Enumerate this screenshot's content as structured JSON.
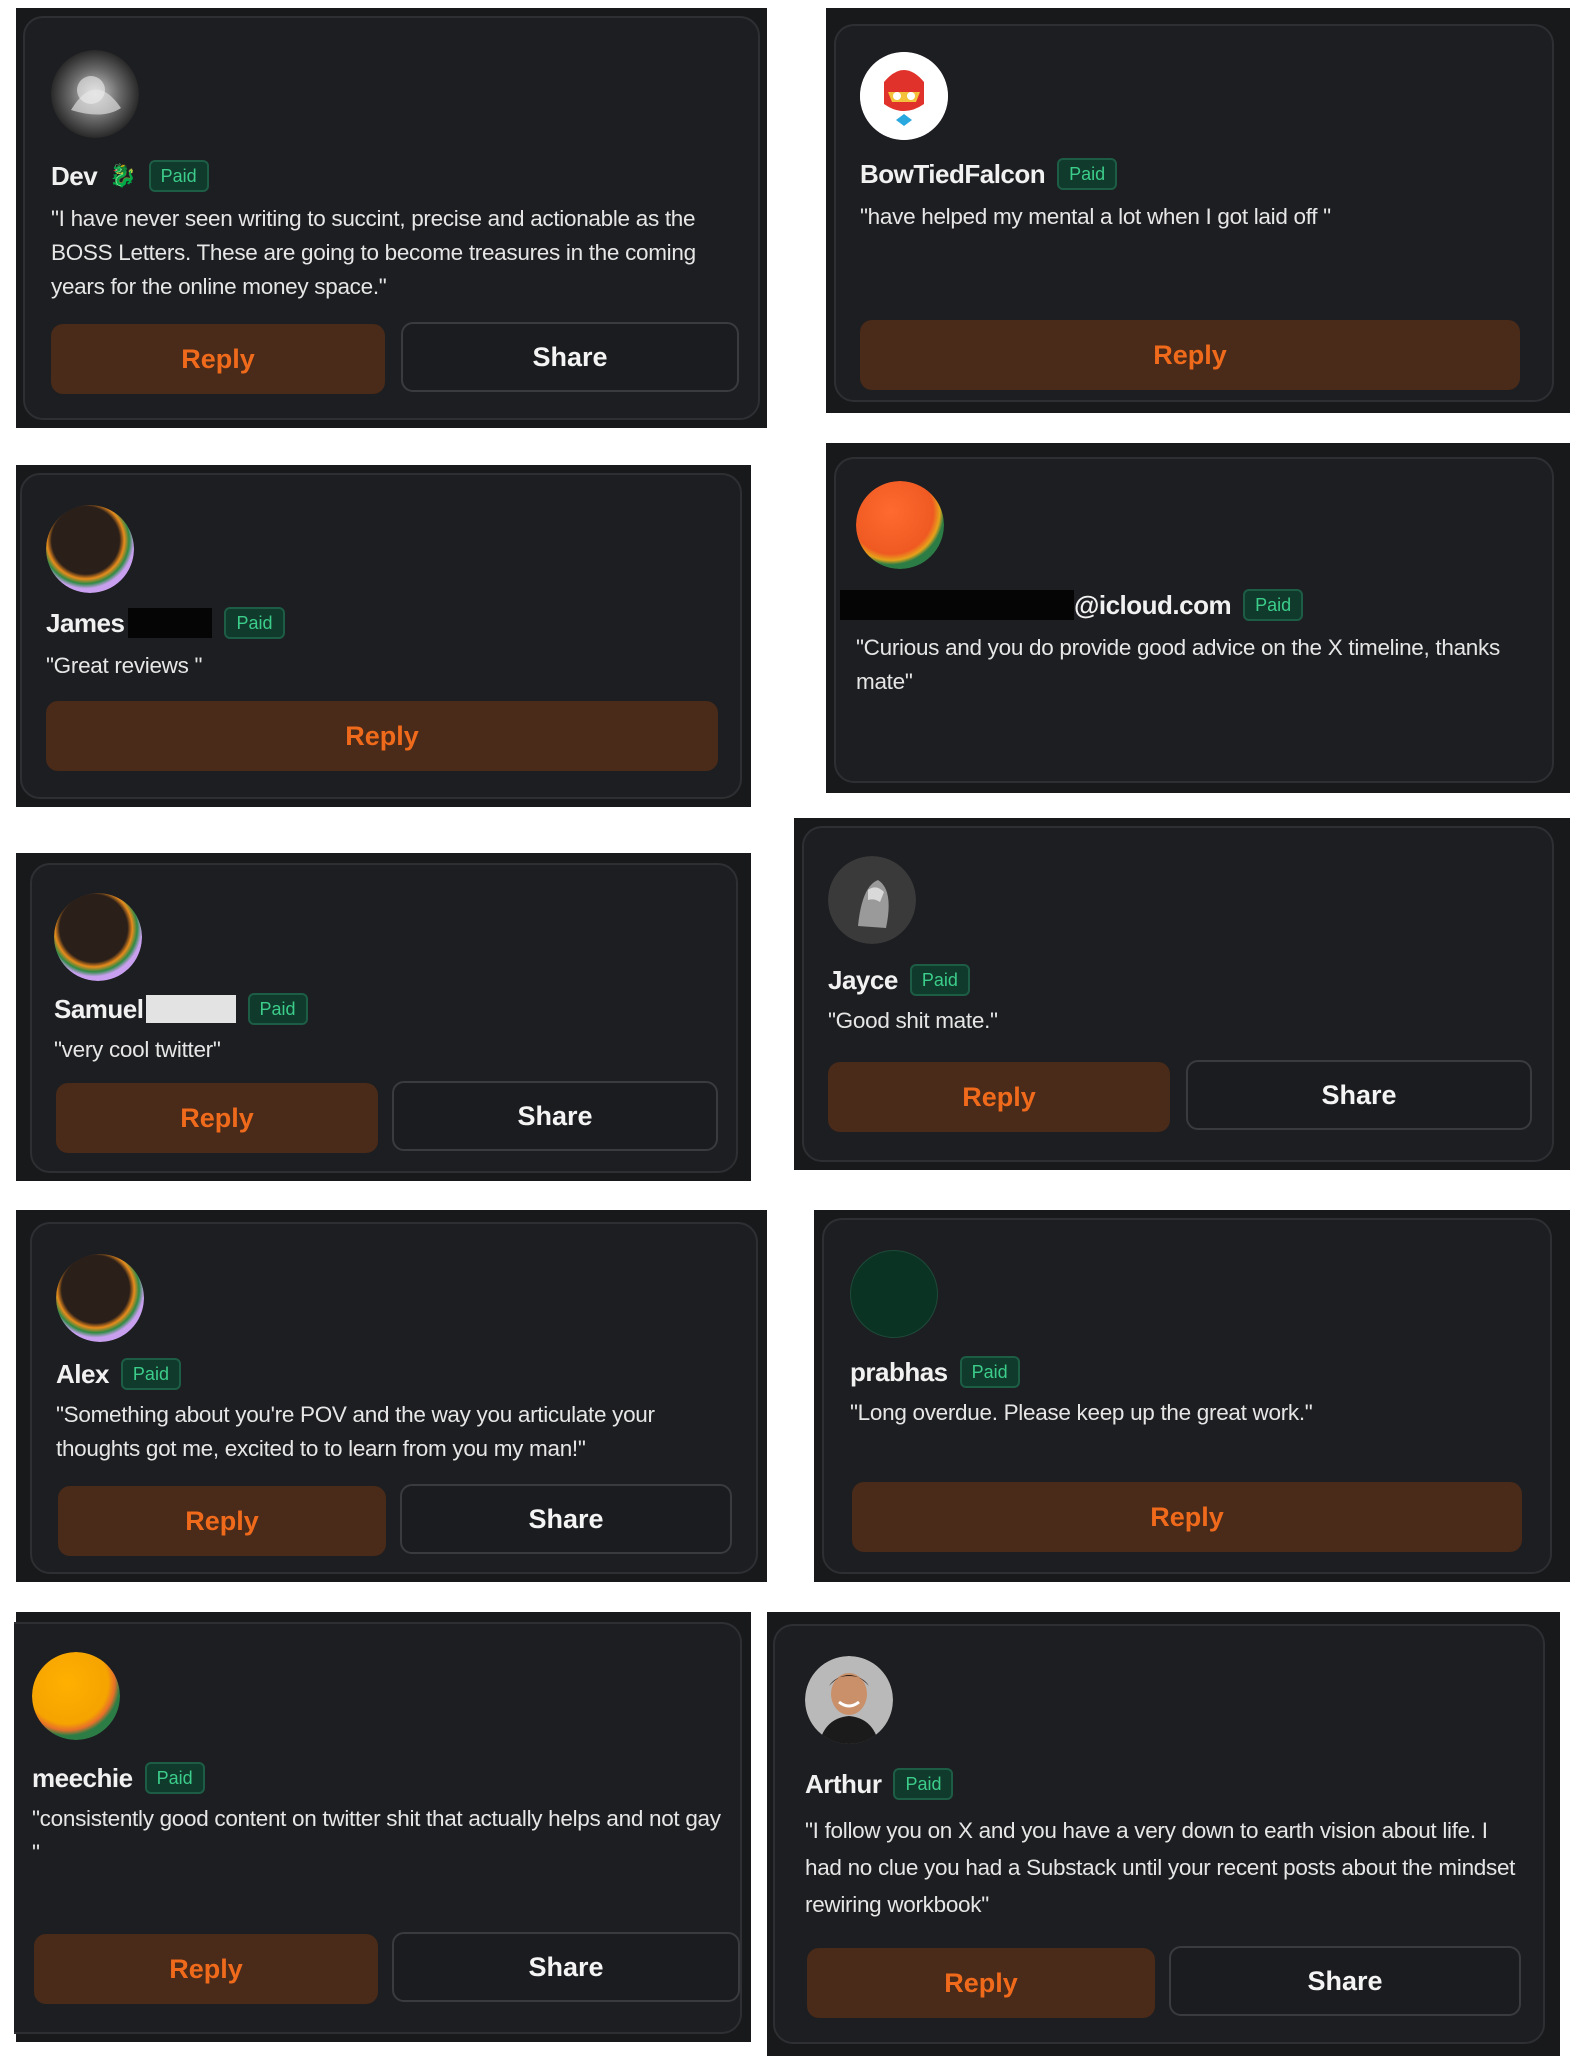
{
  "badge_label": "Paid",
  "colors": {
    "accent": "#f06a1c",
    "reply_bg": "#4a2a18",
    "badge_text": "#3ccd8a",
    "panel_bg": "#18191b"
  },
  "comments": [
    {
      "name": "Dev",
      "name_icon": "fire-dragon-icon",
      "quote": "\"I have never seen writing to succint, precise and actionable as the BOSS Letters. These are going to become treasures in the coming years for the online money space.\"",
      "reply": "Reply",
      "share": "Share",
      "avatar": "bw-photo"
    },
    {
      "name": "BowTiedFalcon",
      "quote": "\"have helped my mental a lot when I got laid off \"",
      "reply": "Reply",
      "avatar": "falcon-mascot"
    },
    {
      "name": "James",
      "quote": "\"Great reviews \"",
      "reply": "Reply",
      "avatar": "gradient-ring"
    },
    {
      "name": "@icloud.com",
      "quote": "\"Curious and you do provide good advice on the X timeline, thanks mate\"",
      "avatar": "orange-orb"
    },
    {
      "name": "Samuel",
      "quote": "\"very cool twitter\"",
      "reply": "Reply",
      "share": "Share",
      "avatar": "gradient-ring"
    },
    {
      "name": "Jayce",
      "quote": "\"Good shit mate.\"",
      "reply": "Reply",
      "share": "Share",
      "avatar": "bw-photo"
    },
    {
      "name": "Alex",
      "quote": "\"Something about you're POV and the way you articulate your thoughts got me, excited to to learn from you my man!\"",
      "reply": "Reply",
      "share": "Share",
      "avatar": "gradient-ring"
    },
    {
      "name": "prabhas",
      "quote": "\"Long overdue. Please keep up the great work.\"",
      "reply": "Reply",
      "avatar": "dark-green-circle"
    },
    {
      "name": "meechie",
      "quote": "\"consistently good content on twitter shit that actually helps and not gay \"",
      "reply": "Reply",
      "share": "Share",
      "avatar": "yellow-orb"
    },
    {
      "name": "Arthur",
      "quote": "\"I follow you on X and you have a very down to earth vision about life. I had no clue you had a Substack until your recent posts about the mindset rewiring workbook\"",
      "reply": "Reply",
      "share": "Share",
      "avatar": "man-photo"
    }
  ]
}
